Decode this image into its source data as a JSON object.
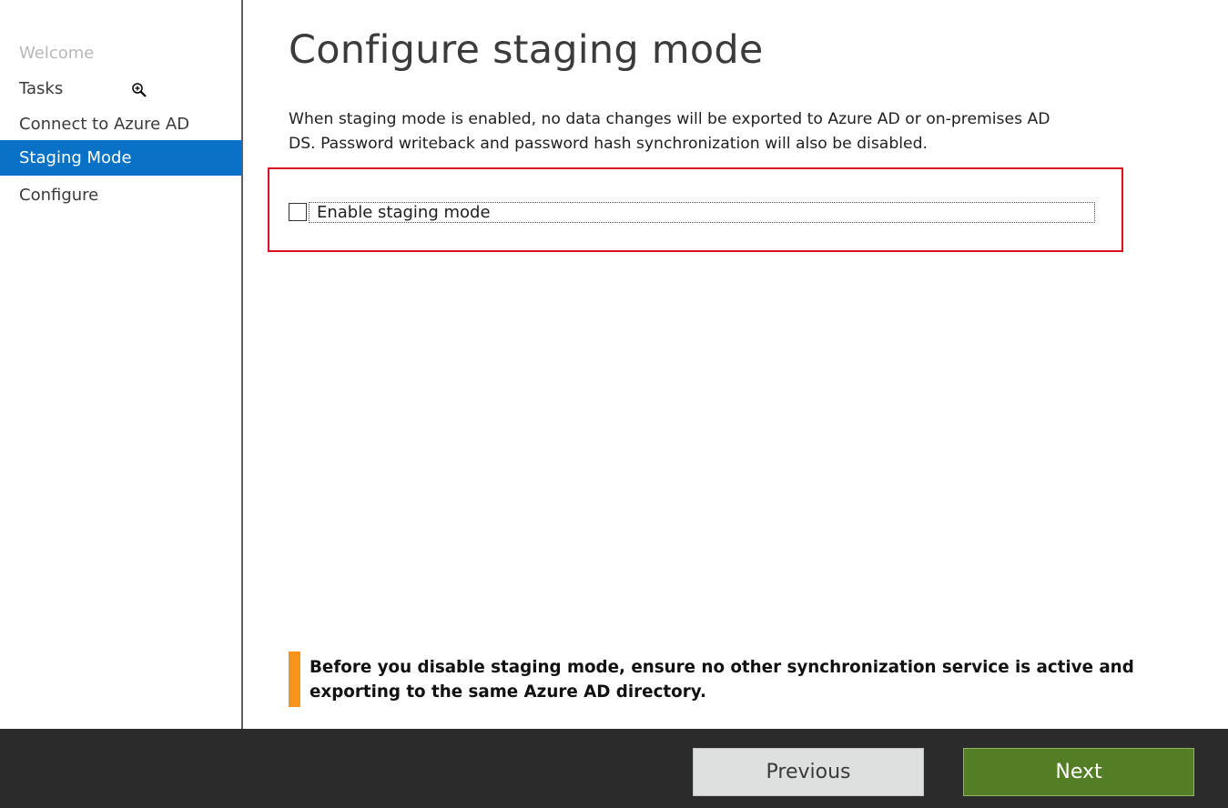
{
  "sidebar": {
    "items": [
      {
        "label": "Welcome",
        "state": "disabled"
      },
      {
        "label": "Tasks",
        "state": "normal"
      },
      {
        "label": "Connect to Azure AD",
        "state": "normal"
      },
      {
        "label": "Staging Mode",
        "state": "active"
      },
      {
        "label": "Configure",
        "state": "normal"
      }
    ]
  },
  "main": {
    "title": "Configure staging mode",
    "description_line1": "When staging mode is enabled, no data changes will be exported to Azure AD or on-premises AD",
    "description_line2": "DS. Password writeback and password hash synchronization will also be disabled.",
    "checkbox": {
      "label": "Enable staging mode",
      "checked": false
    },
    "warning": {
      "text": "Before you disable staging mode, ensure no other synchronization service is active and exporting to the same Azure AD directory."
    }
  },
  "footer": {
    "previous_label": "Previous",
    "next_label": "Next"
  },
  "colors": {
    "accent_blue": "#0a72c6",
    "highlight_red": "#d90f1f",
    "warning_orange": "#f8941a",
    "next_green": "#547e25",
    "footer_dark": "#2b2b2b"
  },
  "icons": {
    "cursor": "zoom-in-icon"
  }
}
